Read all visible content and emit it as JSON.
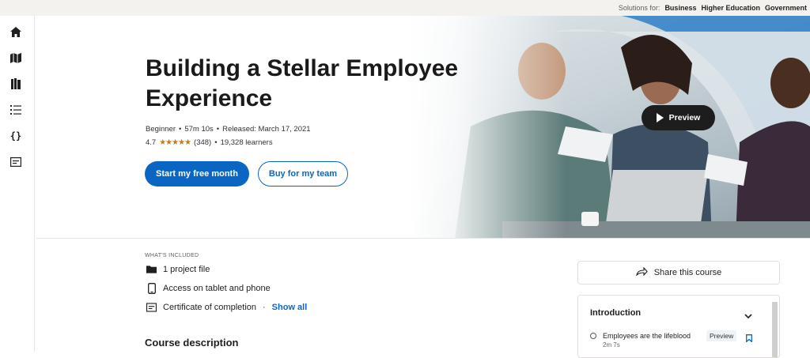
{
  "topbar": {
    "solutions_label": "Solutions for:",
    "links": [
      "Business",
      "Higher Education",
      "Government"
    ]
  },
  "rail": {
    "icons": [
      "home-icon",
      "map-icon",
      "library-icon",
      "list-icon",
      "code-icon",
      "card-icon"
    ]
  },
  "course": {
    "title": "Building a Stellar Employee Experience",
    "level": "Beginner",
    "duration": "57m 10s",
    "released": "Released: March 17, 2021",
    "rating": "4.7",
    "rating_count": "(348)",
    "learners": "19,328 learners",
    "primary_cta": "Start my free month",
    "secondary_cta": "Buy for my team",
    "preview_label": "Preview"
  },
  "included": {
    "label": "WHAT'S INCLUDED",
    "items": [
      {
        "icon": "folder-icon",
        "text": "1 project file"
      },
      {
        "icon": "phone-icon",
        "text": "Access on tablet and phone"
      },
      {
        "icon": "certificate-icon",
        "text": "Certificate of completion"
      }
    ],
    "show_all": "Show all"
  },
  "description_heading": "Course description",
  "share_label": "Share this course",
  "toc": {
    "section": "Introduction",
    "items": [
      {
        "title": "Employees are the lifeblood",
        "duration": "2m 7s",
        "tag": "Preview"
      }
    ]
  },
  "colors": {
    "accent": "#0a66c2",
    "star": "#c37d16"
  }
}
